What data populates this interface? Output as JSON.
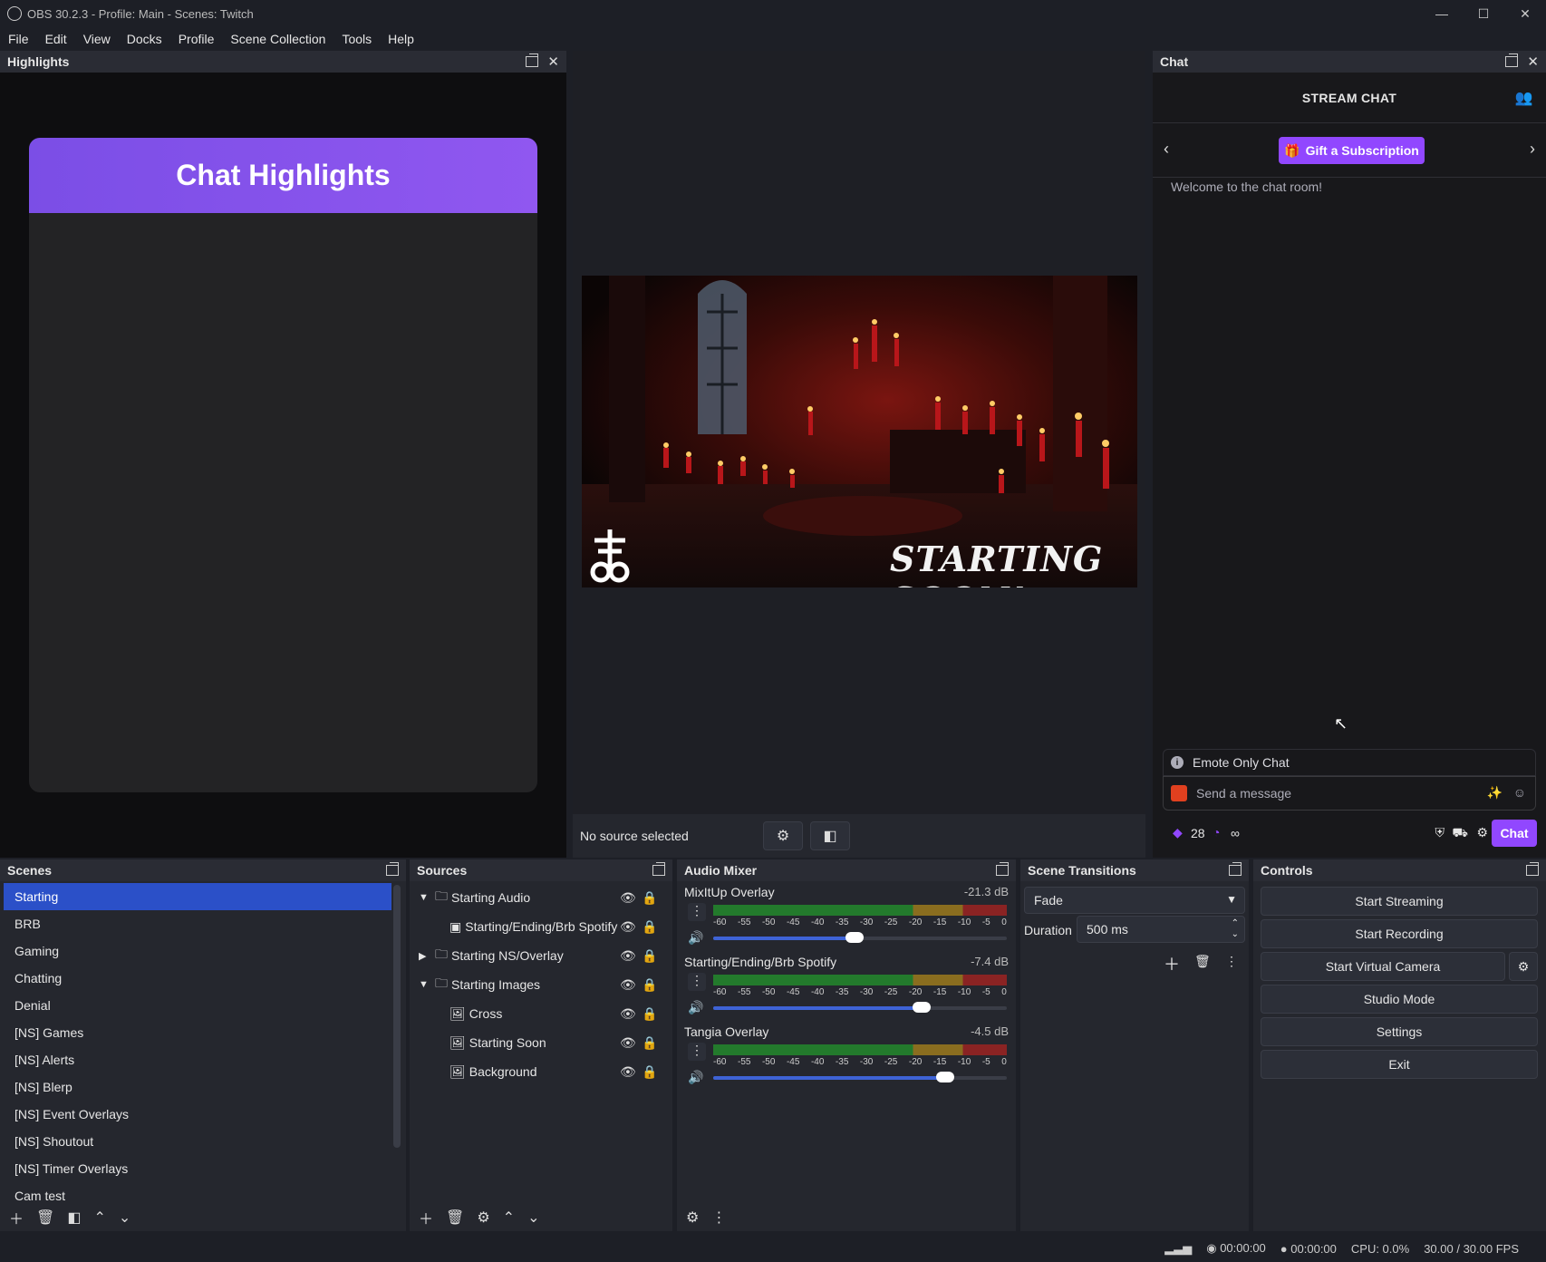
{
  "window": {
    "title": "OBS 30.2.3 - Profile: Main - Scenes: Twitch",
    "min": "—",
    "max": "☐",
    "close": "✕"
  },
  "menu": [
    "File",
    "Edit",
    "View",
    "Docks",
    "Profile",
    "Scene Collection",
    "Tools",
    "Help"
  ],
  "highlights": {
    "dock_title": "Highlights",
    "card_title": "Chat Highlights"
  },
  "preview": {
    "overlay_text": "STARTING SOON!",
    "status": "No source selected"
  },
  "chat": {
    "dock_title": "Chat",
    "header": "STREAM CHAT",
    "gift_button": "Gift a Subscription",
    "welcome": "Welcome to the chat room!",
    "emote_only": "Emote Only Chat",
    "placeholder": "Send a message",
    "points": "28",
    "infinity": "∞",
    "chat_button": "Chat"
  },
  "scenes": {
    "title": "Scenes",
    "items": [
      "Starting",
      "BRB",
      "Gaming",
      "Chatting",
      "Denial",
      "[NS] Games",
      "[NS] Alerts",
      "[NS] Blerp",
      "[NS] Event Overlays",
      "[NS] Shoutout",
      "[NS] Timer Overlays",
      "Cam test"
    ],
    "selected": "Starting"
  },
  "sources": {
    "title": "Sources",
    "items": [
      {
        "label": "Starting Audio",
        "indent": 0,
        "arrow": "▼",
        "icon": "folder-icon"
      },
      {
        "label": "Starting/Ending/Brb Spotify",
        "indent": 1,
        "arrow": "",
        "icon": "window-capture-icon"
      },
      {
        "label": "Starting NS/Overlay",
        "indent": 0,
        "arrow": "▶",
        "icon": "folder-icon"
      },
      {
        "label": "Starting Images",
        "indent": 0,
        "arrow": "▼",
        "icon": "folder-icon"
      },
      {
        "label": "Cross",
        "indent": 1,
        "arrow": "",
        "icon": "image-icon"
      },
      {
        "label": "Starting Soon",
        "indent": 1,
        "arrow": "",
        "icon": "image-icon"
      },
      {
        "label": "Background",
        "indent": 1,
        "arrow": "",
        "icon": "image-icon"
      }
    ]
  },
  "mixer": {
    "title": "Audio Mixer",
    "ticks": [
      "-60",
      "-55",
      "-50",
      "-45",
      "-40",
      "-35",
      "-30",
      "-25",
      "-20",
      "-15",
      "-10",
      "-5",
      "0"
    ],
    "channels": [
      {
        "name": "MixItUp Overlay",
        "db": "-21.3 dB",
        "volume": 0.48
      },
      {
        "name": "Starting/Ending/Brb Spotify",
        "db": "-7.4 dB",
        "volume": 0.71
      },
      {
        "name": "Tangia Overlay",
        "db": "-4.5 dB",
        "volume": 0.79
      }
    ]
  },
  "transitions": {
    "title": "Scene Transitions",
    "selected": "Fade",
    "duration_label": "Duration",
    "duration_value": "500 ms"
  },
  "controls": {
    "title": "Controls",
    "buttons": [
      "Start Streaming",
      "Start Recording",
      "Start Virtual Camera",
      "Studio Mode",
      "Settings",
      "Exit"
    ]
  },
  "status": {
    "stream_time": "00:00:00",
    "rec_time": "00:00:00",
    "cpu": "CPU: 0.0%",
    "fps": "30.00 / 30.00 FPS"
  },
  "colors": {
    "accent": "#2b50c8",
    "twitch_purple": "#9147ff",
    "highlight_purple": "#8652ec"
  }
}
